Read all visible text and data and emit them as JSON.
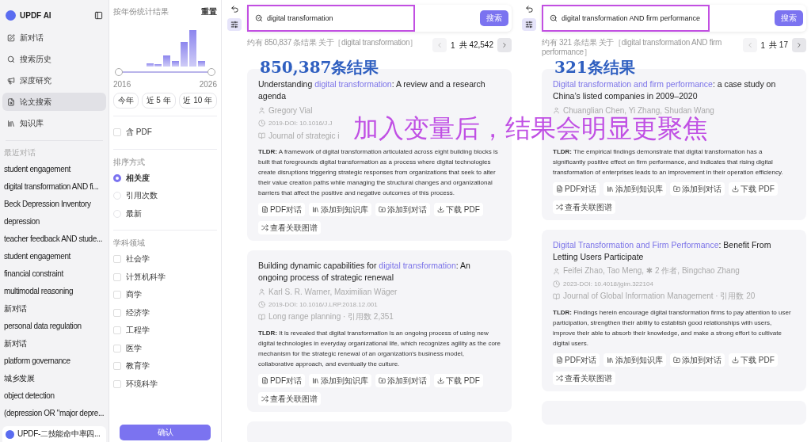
{
  "sidebar": {
    "brand": "UPDF AI",
    "nav": [
      {
        "kind": "new",
        "label": "新对话",
        "selected": false
      },
      {
        "kind": "history",
        "label": "搜索历史",
        "selected": false
      },
      {
        "kind": "research",
        "label": "深度研究",
        "selected": false
      },
      {
        "kind": "papers",
        "label": "论文搜索",
        "selected": true
      },
      {
        "kind": "library",
        "label": "知识库",
        "selected": false
      }
    ],
    "recent_title": "最近对话",
    "recent": [
      "student engagement",
      "digital transformation AND fi...",
      "Beck Depression Inventory",
      "depression",
      "teacher feedback AND stude...",
      "student engagement",
      "financial constraint",
      "multimodal reasoning",
      "新对话",
      "personal data regulation",
      "新对话",
      "platform governance",
      "城乡发展",
      "object detection",
      "(depression OR \"major depre..."
    ],
    "footer": "UPDF-二技能命中率四..."
  },
  "filter": {
    "title": "按年份统计结果",
    "reset": "重置",
    "year_start": "2016",
    "year_end": "2026",
    "range": {
      "level": 1
    },
    "presets": [
      "今年",
      "近 5 年",
      "近 10 年"
    ],
    "pdf_option": {
      "label": "含 PDF",
      "checked": false
    },
    "sort_title": "排序方式",
    "sort_options": [
      {
        "label": "相关度",
        "selected": true
      },
      {
        "label": "引用次数",
        "selected": false
      },
      {
        "label": "最新",
        "selected": false
      }
    ],
    "subject_title": "学科领域",
    "subjects": [
      {
        "label": "社会学",
        "checked": false
      },
      {
        "label": "计算机科学",
        "checked": false
      },
      {
        "label": "商学",
        "checked": false
      },
      {
        "label": "经济学",
        "checked": false
      },
      {
        "label": "工程学",
        "checked": false
      },
      {
        "label": "医学",
        "checked": false
      },
      {
        "label": "教育学",
        "checked": false
      },
      {
        "label": "环境科学",
        "checked": false
      }
    ],
    "confirm": "确认"
  },
  "panes": [
    {
      "query": "digital transformation",
      "highlighted": true,
      "search_button": "搜索",
      "result_count": "约有 850,837 条结果 关于［digital transformation］",
      "annotation": "850,387条结果",
      "page": "1",
      "total": "共 42,542",
      "cards": [
        {
          "title": [
            {
              "text": "Understanding ",
              "highlight": false
            },
            {
              "text": "digital transformation",
              "highlight": true
            },
            {
              "text": ": A review and a research agenda",
              "highlight": false
            }
          ],
          "meta": [
            {
              "kind": "author",
              "text": "Gregory Vial"
            },
            {
              "kind": "doi",
              "text": "2019-DOI: 10.1016/J.J"
            },
            {
              "kind": "journal",
              "text": "Journal of strategic i"
            }
          ],
          "tldr_label": "TLDR:",
          "tldr": "A framework of digital transformation articulated across eight building blocks is built that foregrounds digital transformation as a process where digital technologies create disruptions triggering strategic responses from organizations that seek to alter their value creation paths while managing the structural changes and organizational barriers that affect the positive and negative outcomes of this process.",
          "actions": [
            {
              "kind": "pdf_chat",
              "label": "PDF对话"
            },
            {
              "kind": "add_library",
              "label": "添加到知识库"
            },
            {
              "kind": "add_chat",
              "label": "添加到对话"
            },
            {
              "kind": "download",
              "label": "下载 PDF"
            },
            {
              "kind": "graph",
              "label": "查看关联图谱"
            }
          ]
        },
        {
          "title": [
            {
              "text": "Building dynamic capabilities for ",
              "highlight": false
            },
            {
              "text": "digital transformation",
              "highlight": true
            },
            {
              "text": ": An ongoing process of strategic renewal",
              "highlight": false
            }
          ],
          "meta": [
            {
              "kind": "author",
              "text": "Karl S. R. Warner, Maximilian Wäger"
            },
            {
              "kind": "doi",
              "text": "2019-DOI: 10.1016/J.LRP.2018.12.001"
            },
            {
              "kind": "journal",
              "text": "Long range planning · 引用数 2,351"
            }
          ],
          "tldr_label": "TLDR:",
          "tldr": "It is revealed that digital transformation is an ongoing process of using new digital technologies in everyday organizational life, which recognizes agility as the core mechanism for the strategic renewal of an organization's business model, collaborative approach, and eventually the culture.",
          "actions": [
            {
              "kind": "pdf_chat",
              "label": "PDF对话"
            },
            {
              "kind": "add_library",
              "label": "添加到知识库"
            },
            {
              "kind": "add_chat",
              "label": "添加到对话"
            },
            {
              "kind": "download",
              "label": "下载 PDF"
            },
            {
              "kind": "graph",
              "label": "查看关联图谱"
            }
          ]
        }
      ]
    },
    {
      "query": "digital transformation AND firm performance",
      "highlighted": true,
      "search_button": "搜索",
      "result_count": "约有 321 条结果 关于［digital transformation AND firm performance］",
      "annotation": "321条结果",
      "page": "1",
      "total": "共 17",
      "cards": [
        {
          "title": [
            {
              "text": "Digital transformation and firm performance",
              "highlight": true
            },
            {
              "text": ": a case study on China’s listed companies in 2009–2020",
              "highlight": false
            }
          ],
          "meta": [
            {
              "kind": "author",
              "text": "Chuanglian Chen, Yi Zhang, Shudan Wang"
            }
          ],
          "tldr_label": "TLDR:",
          "tldr": "The empirical findings demonstrate that digital transformation has a significantly positive effect on firm performance, and indicates that rising digital transformation of enterprises leads to an improvement in their operation efficiency.",
          "actions": [
            {
              "kind": "pdf_chat",
              "label": "PDF对话"
            },
            {
              "kind": "add_library",
              "label": "添加到知识库"
            },
            {
              "kind": "add_chat",
              "label": "添加到对话"
            },
            {
              "kind": "download",
              "label": "下载 PDF"
            },
            {
              "kind": "graph",
              "label": "查看关联图谱"
            }
          ]
        },
        {
          "title": [
            {
              "text": "Digital Transformation and Firm Performance",
              "highlight": true
            },
            {
              "text": ": Benefit From Letting Users Participate",
              "highlight": false
            }
          ],
          "meta": [
            {
              "kind": "author",
              "text": "Feifei Zhao, Tao Meng, ✱ 2 作者, Bingchao Zhang"
            },
            {
              "kind": "doi",
              "text": "2023-DOI: 10.4018/jgim.322104"
            },
            {
              "kind": "journal",
              "text": "Journal of Global Information Management · 引用数 20"
            }
          ],
          "tldr_label": "TLDR:",
          "tldr": "Findings herein encourage digital transformation firms to pay attention to user participation, strengthen their ability to establish good relationships with users, improve their able to absorb their knowledge, and make a strong effort to cultivate digital users.",
          "actions": [
            {
              "kind": "pdf_chat",
              "label": "PDF对话"
            },
            {
              "kind": "add_library",
              "label": "添加到知识库"
            },
            {
              "kind": "add_chat",
              "label": "添加到对话"
            },
            {
              "kind": "download",
              "label": "下载 PDF"
            },
            {
              "kind": "graph",
              "label": "查看关联图谱"
            }
          ]
        }
      ]
    }
  ],
  "caption": "加入变量后，结果会明显更聚焦"
}
